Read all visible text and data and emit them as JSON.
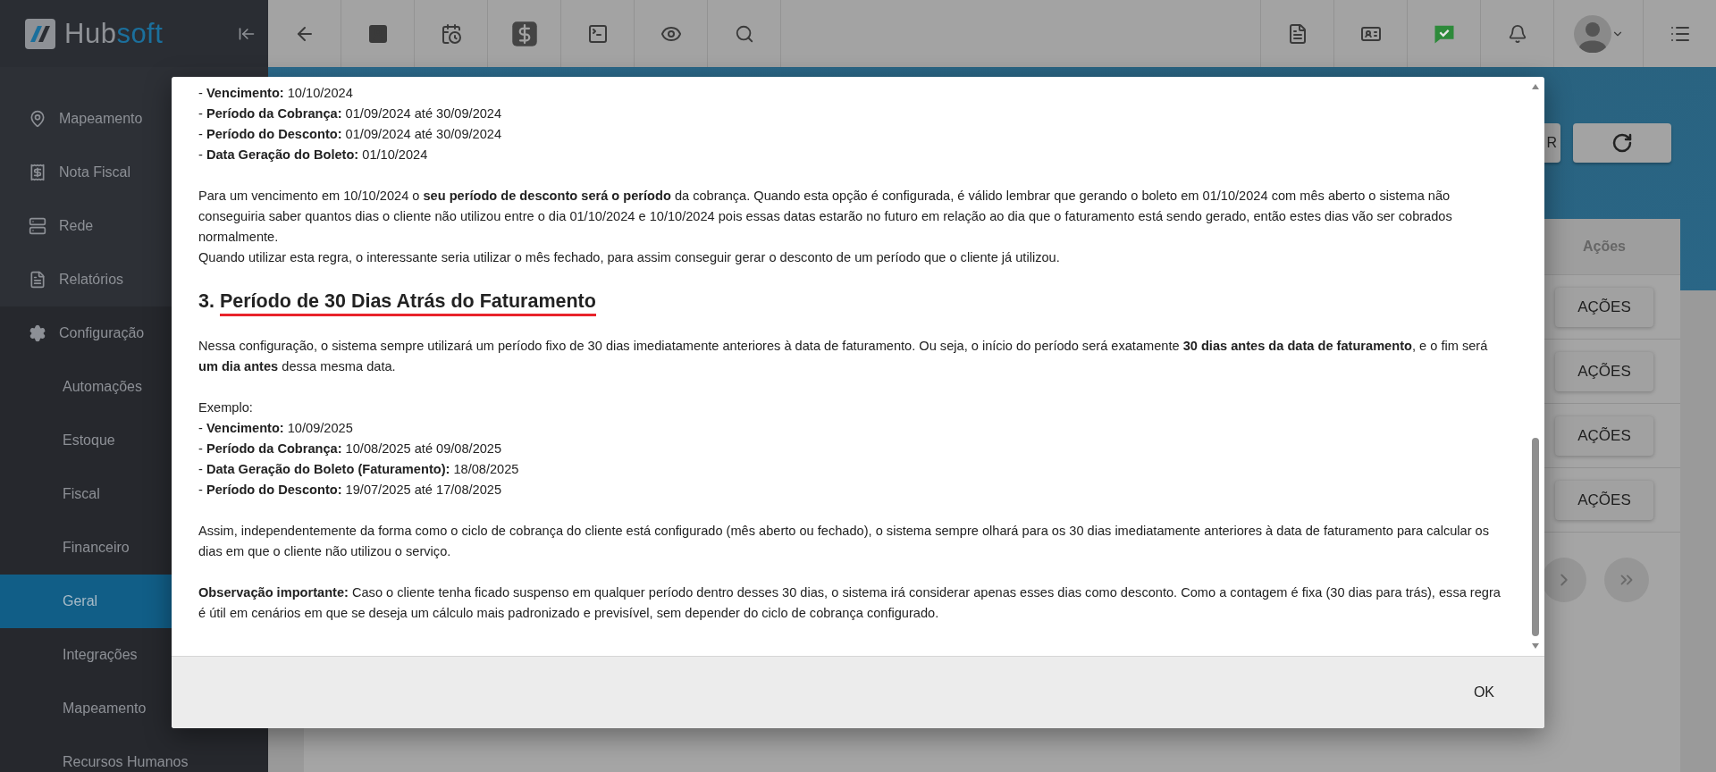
{
  "topbar": {
    "brand_prefix": "Hub",
    "brand_suffix": "soft"
  },
  "sidebar": {
    "items": [
      {
        "label": "Mapeamento",
        "selected": false
      },
      {
        "label": "Nota Fiscal",
        "selected": false
      },
      {
        "label": "Rede",
        "selected": false
      },
      {
        "label": "Relatórios",
        "selected": false
      },
      {
        "label": "Configuração",
        "selected": false,
        "children": [
          {
            "label": "Automações",
            "selected": false
          },
          {
            "label": "Estoque",
            "selected": false
          },
          {
            "label": "Fiscal",
            "selected": false
          },
          {
            "label": "Financeiro",
            "selected": false
          },
          {
            "label": "Geral",
            "selected": true
          },
          {
            "label": "Integrações",
            "selected": false
          },
          {
            "label": "Mapeamento",
            "selected": false
          },
          {
            "label": "Recursos Humanos",
            "selected": false
          }
        ]
      }
    ]
  },
  "page": {
    "partial_button": "R",
    "table": {
      "columns": [
        "Ações"
      ],
      "rows": [
        {
          "action": "AÇÕES"
        },
        {
          "action": "AÇÕES"
        },
        {
          "action": "AÇÕES"
        },
        {
          "action": "AÇÕES"
        }
      ]
    }
  },
  "dialog": {
    "blocks": [
      {
        "kind": "list",
        "lines": [
          "- **Vencimento:** 10/10/2024",
          "- **Período da Cobrança:** 01/09/2024 até 30/09/2024",
          "- **Período do Desconto:** 01/09/2024 até 30/09/2024",
          "- **Data Geração do Boleto:** 01/10/2024"
        ]
      },
      {
        "kind": "paragraph",
        "lines": [
          "Para um vencimento em 10/10/2024 o **seu período de desconto será o período** da cobrança. Quando esta opção é configurada, é válido lembrar que gerando o boleto em 01/10/2024 com mês aberto o sistema não conseguiria saber quantos dias o cliente não utilizou entre o dia 01/10/2024 e 10/10/2024 pois essas datas estarão no futuro em relação ao dia que o faturamento está sendo gerado, então estes dias vão ser cobrados normalmente.",
          "Quando utilizar esta regra, o interessante seria utilizar o mês fechado, para assim conseguir gerar o desconto de um período que o cliente já utilizou."
        ]
      },
      {
        "kind": "heading",
        "number": "3.",
        "text": "Período de 30 Dias Atrás do Faturamento"
      },
      {
        "kind": "paragraph",
        "lines": [
          "Nessa configuração, o sistema sempre utilizará um período fixo de 30 dias imediatamente anteriores à data de faturamento. Ou seja, o início do período será exatamente **30 dias antes da data de faturamento**, e o fim será **um dia antes** dessa mesma data."
        ]
      },
      {
        "kind": "list",
        "lines": [
          "Exemplo:",
          "- **Vencimento:** 10/09/2025",
          "- **Período da Cobrança:** 10/08/2025 até 09/08/2025",
          "- **Data Geração do Boleto (Faturamento):** 18/08/2025",
          "- **Período do Desconto:** 19/07/2025 até 17/08/2025"
        ]
      },
      {
        "kind": "paragraph",
        "lines": [
          "Assim, independentemente da forma como o ciclo de cobrança do cliente está configurado (mês aberto ou fechado), o sistema sempre olhará para os 30 dias imediatamente anteriores à data de faturamento para calcular os dias em que o cliente não utilizou o serviço."
        ]
      },
      {
        "kind": "paragraph",
        "lines": [
          "**Observação importante:** Caso o cliente tenha ficado suspenso em qualquer período dentro desses 30 dias, o sistema irá considerar apenas esses dias como desconto. Como a contagem é fixa (30 dias para trás), essa regra é útil em cenários em que se deseja um cálculo mais padronizado e previsível, sem depender do ciclo de cobrança configurado."
        ]
      }
    ],
    "ok_button": "OK"
  }
}
